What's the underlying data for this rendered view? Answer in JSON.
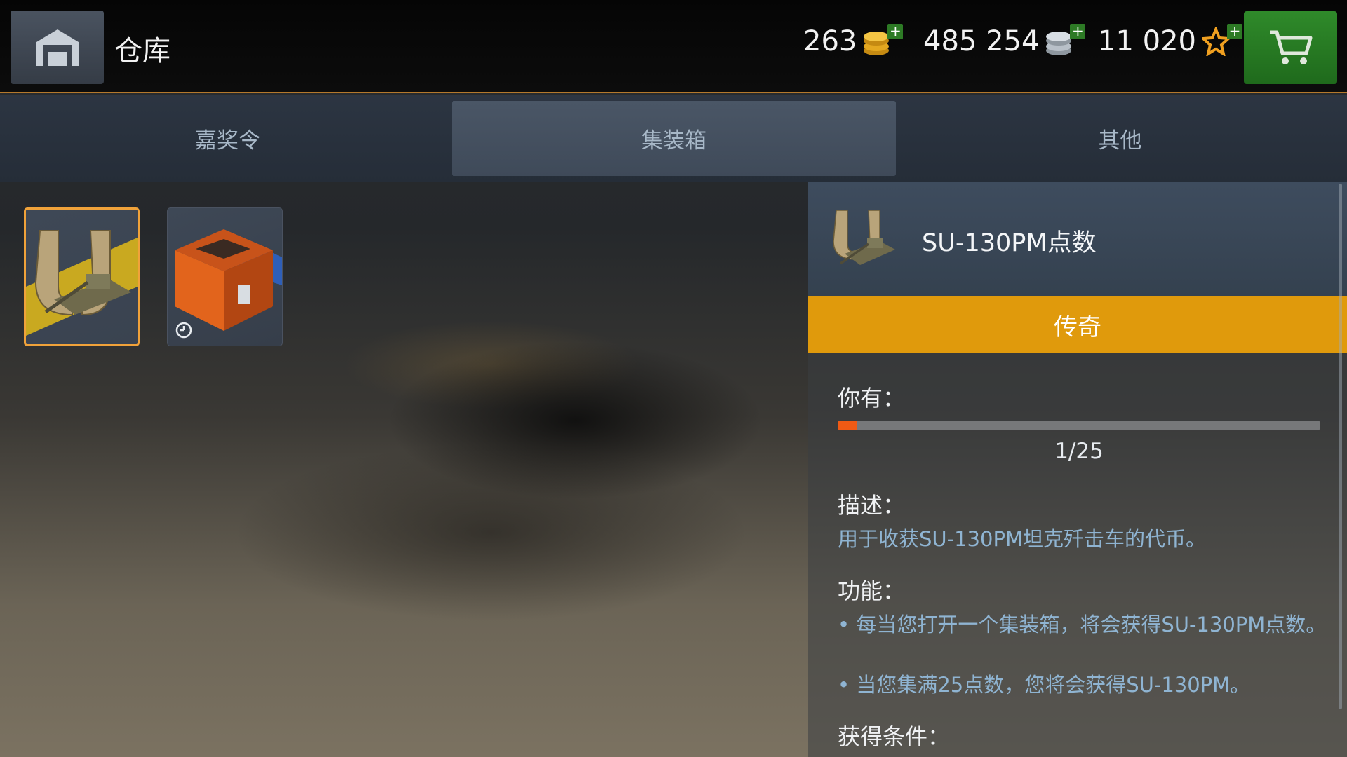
{
  "topbar": {
    "title": "仓库",
    "gold": "263",
    "silver": "485 254",
    "free_xp": "11 020",
    "plus": "+"
  },
  "tabs": [
    {
      "label": "嘉奖令",
      "active": false
    },
    {
      "label": "集装箱",
      "active": true
    },
    {
      "label": "其他",
      "active": false
    }
  ],
  "items": [
    {
      "name": "SU-130PM点数",
      "selected": true
    },
    {
      "name": "container",
      "selected": false
    }
  ],
  "detail": {
    "name": "SU-130PM点数",
    "rarity": "传奇",
    "have_label": "你有：",
    "progress": 0.04,
    "count": "1/25",
    "desc_label": "描述：",
    "desc_text": "用于收获SU-130PM坦克歼击车的代币。",
    "func_label": "功能：",
    "func_1": "• 每当您打开一个集装箱，将会获得SU-130PM点数。",
    "func_2": "• 当您集满25点数，您将会获得SU-130PM。",
    "cond_label": "获得条件："
  },
  "colors": {
    "accent_orange": "#f0a23a",
    "rarity_gold": "#e09a0c",
    "progress_fill": "#f05a14",
    "cart_green": "#2f8a2a",
    "text_blue": "#8fb4d2"
  },
  "icons": [
    "garage-home-icon",
    "gold-coins-icon",
    "silver-coins-icon",
    "star-icon",
    "cart-icon",
    "timer-icon"
  ]
}
